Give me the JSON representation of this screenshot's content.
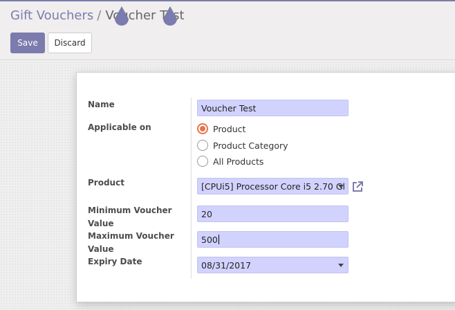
{
  "breadcrumb": {
    "parent": "Gift Vouchers",
    "separator": "/",
    "current": "Voucher Test"
  },
  "toolbar": {
    "save_label": "Save",
    "discard_label": "Discard"
  },
  "form": {
    "name_label": "Name",
    "name_value": "Voucher Test",
    "applicable_label": "Applicable on",
    "applicable_options": [
      "Product",
      "Product Category",
      "All Products"
    ],
    "applicable_selected": "Product",
    "product_label": "Product",
    "product_value": "[CPUi5] Processor Core i5 2.70 Gl",
    "min_label": "Minimum Voucher Value",
    "min_value": "20",
    "max_label": "Maximum Voucher Value",
    "max_value": "500",
    "expiry_label": "Expiry Date",
    "expiry_value": "08/31/2017"
  },
  "icons": {
    "external_link": "external-link-icon",
    "dropdown": "caret-down-icon",
    "pin": "drop-pin-icon"
  },
  "colors": {
    "brand": "#7c7bad",
    "input_bg": "#d2d2ff",
    "radio_accent": "#e8734d"
  }
}
